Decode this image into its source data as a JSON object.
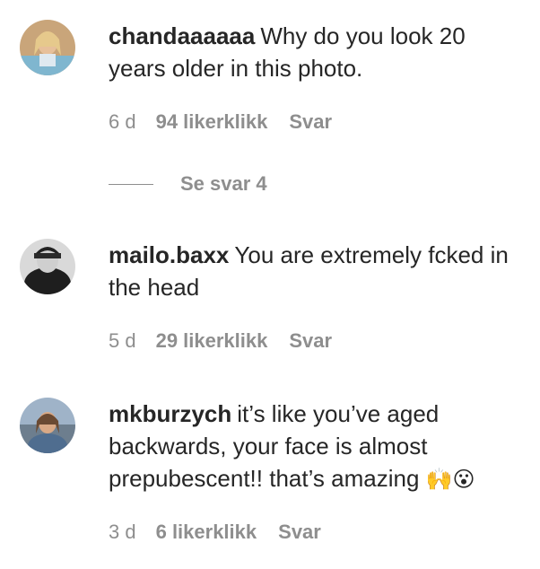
{
  "comments": [
    {
      "username": "chandaaaaaa",
      "text": "Why do you look 20 years older in this photo.",
      "time": "6 d",
      "likes": "94 likerklikk",
      "reply": "Svar"
    },
    {
      "username": "mailo.baxx",
      "text": "You are extremely fcked in the head",
      "time": "5 d",
      "likes": "29 likerklikk",
      "reply": "Svar"
    },
    {
      "username": "mkburzych",
      "text": "it’s like you’ve aged backwards, your face is almost prepubescent!! that’s amazing",
      "emoji": "🙌😮",
      "time": "3 d",
      "likes": "6 likerklikk",
      "reply": "Svar"
    }
  ],
  "replies_toggle": {
    "label": "Se svar 4"
  }
}
